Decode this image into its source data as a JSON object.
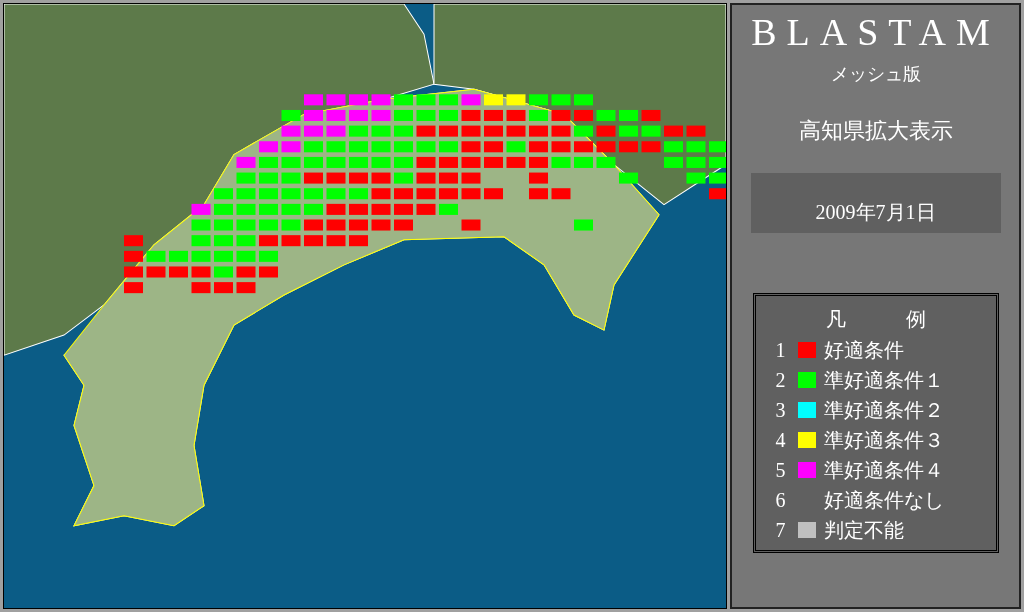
{
  "title": "BLASTAM",
  "subtitle": "メッシュ版",
  "view": "高知県拡大表示",
  "date": "2009年7月1日",
  "legend": {
    "title_left": "凡",
    "title_right": "例",
    "items": [
      {
        "number": "1",
        "label": "好適条件",
        "color": "#ff0000"
      },
      {
        "number": "2",
        "label": "準好適条件１",
        "color": "#00ff00"
      },
      {
        "number": "3",
        "label": "準好適条件２",
        "color": "#00ffff"
      },
      {
        "number": "4",
        "label": "準好適条件３",
        "color": "#ffff00"
      },
      {
        "number": "5",
        "label": "準好適条件４",
        "color": "#ff00ff"
      },
      {
        "number": "6",
        "label": "好適条件なし"
      },
      {
        "number": "7",
        "label": "判定不能",
        "color": "#c0c0c0"
      }
    ]
  }
}
